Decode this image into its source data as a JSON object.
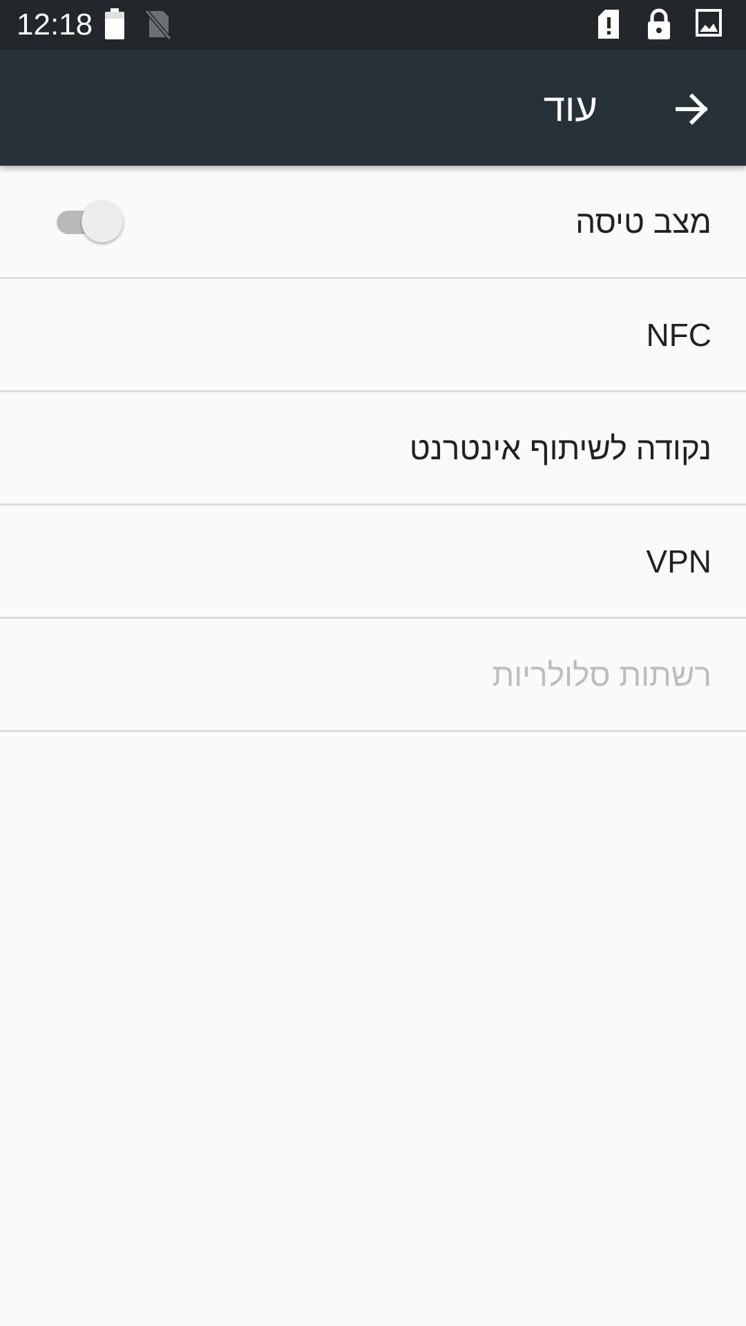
{
  "status_bar": {
    "time": "12:18",
    "icons": [
      "battery-icon",
      "no-sim-icon",
      "sim-alert-icon",
      "lock-icon",
      "image-icon"
    ]
  },
  "toolbar": {
    "title": "עוד",
    "back_icon": "arrow-forward-icon"
  },
  "settings": {
    "items": [
      {
        "label": "מצב טיסה",
        "type": "switch",
        "enabled": true,
        "checked": false
      },
      {
        "label": "NFC",
        "type": "item",
        "enabled": true
      },
      {
        "label": "נקודה לשיתוף אינטרנט",
        "type": "item",
        "enabled": true
      },
      {
        "label": "VPN",
        "type": "item",
        "enabled": true
      },
      {
        "label": "רשתות סלולריות",
        "type": "item",
        "enabled": false
      }
    ]
  },
  "colors": {
    "status_bar": "#21272b",
    "toolbar": "#263238",
    "background": "#fafafa",
    "text_primary": "#212121",
    "text_disabled": "#bdbdbd",
    "divider": "#dcdcdc"
  }
}
